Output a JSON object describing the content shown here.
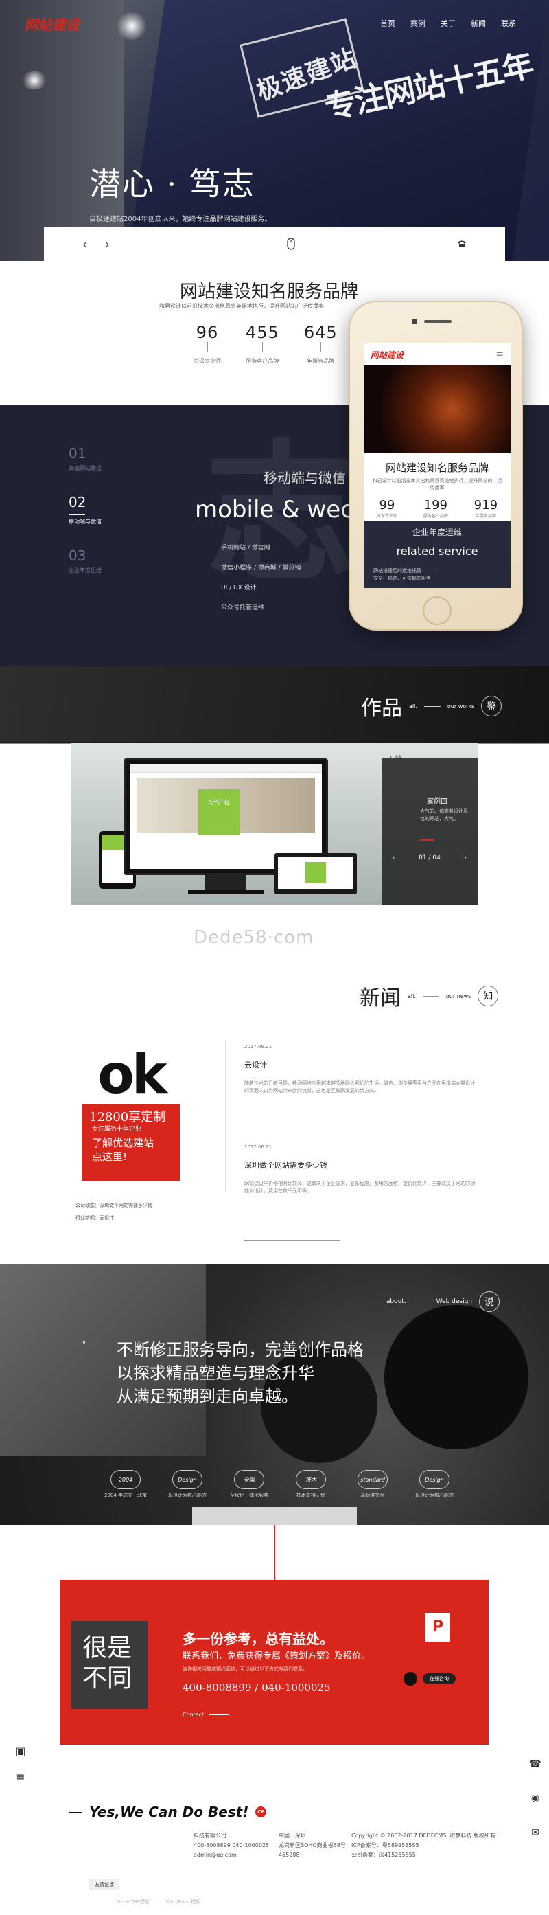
{
  "header": {
    "logo": "网站建设",
    "nav": [
      "首页",
      "案例",
      "关于",
      "新闻",
      "联系"
    ]
  },
  "hero": {
    "seal_text": "极速建站",
    "callig_text": "专注网站十五年",
    "title": "潜心 · 笃志",
    "subtitle": "自极速建站2004年创立以来，始终专注品牌网站建设服务。",
    "prev": "‹",
    "next": "›",
    "mouse_icon": "mouse-icon",
    "phone_icon": "phone-icon"
  },
  "brand": {
    "title": "网站建设知名服务品牌",
    "desc": "和君设计以前沿技术突出格局感英雄地执行，提升网站的广泛传播率",
    "stats": [
      {
        "value": "96",
        "label": "资深专业师"
      },
      {
        "value": "455",
        "label": "服务客户品牌"
      },
      {
        "value": "645",
        "label": "年服务品牌"
      }
    ]
  },
  "mobile": {
    "steps": [
      {
        "num": "01",
        "label": "高端网站建设"
      },
      {
        "num": "02",
        "label": "移动端与微信"
      },
      {
        "num": "03",
        "label": "企业年度运维"
      }
    ],
    "heading": "移动端与微信",
    "heading_en": "mobile & wechat",
    "list": [
      "手机网站 / 微官网",
      "微信小程序 / 微商城 / 微分销",
      "UI / UX 设计",
      "公众号托管运维"
    ],
    "bgchar": "志"
  },
  "phone": {
    "logo": "网站建设",
    "menu_icon": "≡",
    "title": "网站建设知名服务品牌",
    "desc": "和君设计以前沿技术突出格局感英雄地执行，提升网站的广泛传播率",
    "stats": [
      {
        "value": "99",
        "label": "资深专业师"
      },
      {
        "value": "199",
        "label": "服务客户品牌"
      },
      {
        "value": "919",
        "label": "年服务品牌"
      }
    ],
    "dark_h": "企业年度运维",
    "dark_en": "related service",
    "dark_s1": "网站搭建后的运维托管",
    "dark_s2": "安全、稳定、可依赖的服务"
  },
  "works": {
    "title": "作品",
    "en": "all.",
    "sub": "our works",
    "seal": "鉴",
    "case_brand": "万链",
    "case_title": "案例四",
    "case_desc": "大气的、偏商务设计风格的网站，大气。",
    "pager": "01 / 04",
    "monitor_label": "3尸产在",
    "watermark": "Dede58·com"
  },
  "news": {
    "title": "新闻",
    "en": "all.",
    "sub": "our news",
    "seal": "知",
    "ok_big": "ok",
    "ok_num": "12800享定制",
    "ok_s": "专注服务十年企业",
    "ok_c1": "了解优选建站",
    "ok_c2": "点这里!",
    "links": [
      "公司动态：深圳做个网站需要多少钱",
      "行业新闻：云设计"
    ],
    "articles": [
      {
        "date": "2017.06.21",
        "title": "云设计",
        "body": "随着技术的日新月异，移动网络应用越来越多地融入我们的生活。微信、浏览器等平台产品在手机端大量设计的页面入口为网站带来新的流量，这也是互联网发展的新方向。"
      },
      {
        "date": "2017.06.21",
        "title": "深圳做个网站需要多少钱",
        "body": "网站建设中价格相对比较高，这取决于企业需求，复杂程度，费用方面统一定价比较少，主要取决于网站的功能和设计，费用在数千元不等。"
      }
    ]
  },
  "about": {
    "en": "about.",
    "sub": "Web design",
    "seal": "说",
    "quote_mark": "\"",
    "line1": "不断修正服务导向，完善创作品格",
    "line2": "以探求精品塑造与理念升华",
    "line3": "从满足预期到走向卓越。",
    "badges": [
      {
        "b": "2004",
        "l": "2004 年成立于北京"
      },
      {
        "b": "Design",
        "l": "以设计为核心能力"
      },
      {
        "b": "全国",
        "l": "全程化一体化服务"
      },
      {
        "b": "技术",
        "l": "技术支持无忧"
      },
      {
        "b": "standard",
        "l": "高标准交付"
      },
      {
        "b": "Design",
        "l": "以设计为核心能力"
      }
    ]
  },
  "cta": {
    "grey1": "很是",
    "grey2": "不同",
    "heading": "多一份参考，总有益处。",
    "para": "联系我们，免费获得专属《策划方案》及报价。",
    "small": "咨询相关问题或预约面谈，可以通过以下方式与我们联系。",
    "phones": "400-8008899 / 040-1000025",
    "contact": "Contact",
    "ppt": "P",
    "online": "在线咨询"
  },
  "footer": {
    "slogan": "Yes,We Can Do Best!",
    "dot": "CE",
    "col1": [
      "科技有限公司",
      "400-8008899   040-1000025",
      "admin@qq.com"
    ],
    "col2": [
      "中国 · 深圳",
      "龙岗新区SOHO商业楼68号",
      "465288"
    ],
    "col3": [
      "Copyright © 2002-2017 DEDECMS. 织梦科技 版权所有",
      "ICP备案号：粤5899555S5",
      "公司备案：深415255555"
    ],
    "menu": "友情链接",
    "bottom": [
      "DedeCMS模板",
      "WordPress模板"
    ]
  }
}
